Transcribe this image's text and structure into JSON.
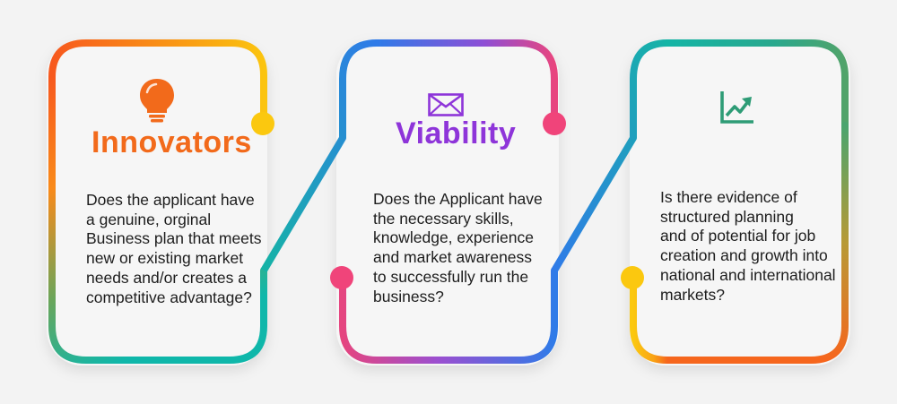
{
  "colors": {
    "background": "#f3f3f3",
    "orange": "#f26a1b",
    "yellow": "#f9c90f",
    "purple": "#8e35d9",
    "pink": "#f0447a",
    "blue": "#2f7be8",
    "teal": "#16b3a6",
    "green": "#2e9c76",
    "text": "#1d1d1d"
  },
  "cards": [
    {
      "title": "Innovators",
      "title_color": "#f26a1b",
      "icon": "lightbulb-icon",
      "text": "Does the applicant have\na genuine, orginal\nBusiness plan that meets\nnew or existing market\nneeds and/or creates a\ncompetitive advantage?"
    },
    {
      "title": "Viability",
      "title_color": "#8e35d9",
      "icon": "envelope-icon",
      "text": "Does the Applicant have\nthe necessary skills,\nknowledge, experience\nand market awareness\nto successfully run the\nbusiness?"
    },
    {
      "title": "",
      "title_color": "#2e9c76",
      "icon": "growth-chart-icon",
      "text": "Is there evidence of\nstructured planning\nand of potential for job\ncreation and growth into\nnational and international\nmarkets?"
    }
  ]
}
